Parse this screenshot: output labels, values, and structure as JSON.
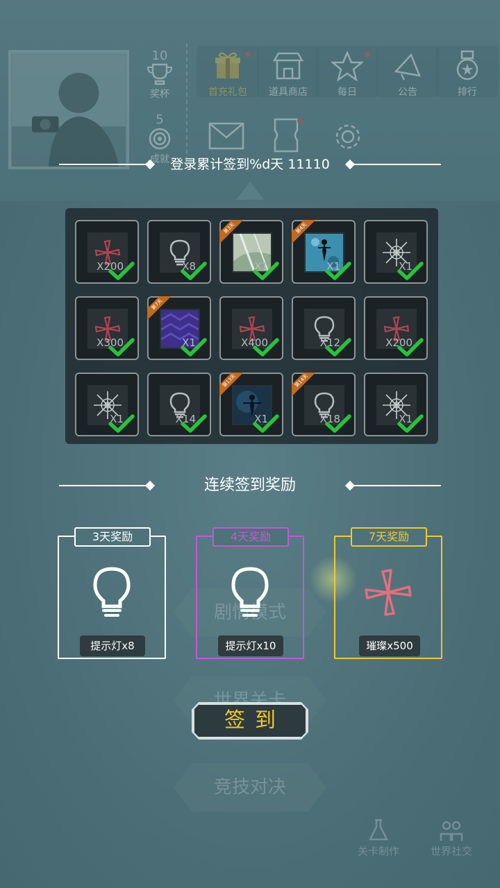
{
  "top_bar": {
    "trophy": {
      "count": "10",
      "label": "奖杯"
    },
    "achievement": {
      "count": "5",
      "label": "成就"
    },
    "shortcuts": [
      {
        "label": "首充礼包",
        "icon": "gift-icon"
      },
      {
        "label": "道具商店",
        "icon": "shop-icon"
      },
      {
        "label": "每日",
        "icon": "star-icon"
      },
      {
        "label": "公告",
        "icon": "megaphone-icon"
      },
      {
        "label": "排行",
        "icon": "medal-icon"
      }
    ]
  },
  "signin": {
    "title": "登录累计签到%d天 11110",
    "grid": [
      {
        "qty": "X200",
        "item": "pinwheel",
        "ribbon": "",
        "checked": true
      },
      {
        "qty": "X8",
        "item": "bulb",
        "ribbon": "",
        "checked": true
      },
      {
        "qty": "X1",
        "item": "scene-card",
        "ribbon": "第3天",
        "checked": true
      },
      {
        "qty": "X1",
        "item": "character-card",
        "ribbon": "第4天",
        "checked": true
      },
      {
        "qty": "X1",
        "item": "snowflake",
        "ribbon": "",
        "checked": true
      },
      {
        "qty": "X300",
        "item": "pinwheel",
        "ribbon": "",
        "checked": true
      },
      {
        "qty": "X1",
        "item": "pattern-card",
        "ribbon": "第7天",
        "checked": true
      },
      {
        "qty": "X400",
        "item": "pinwheel",
        "ribbon": "",
        "checked": true
      },
      {
        "qty": "X12",
        "item": "bulb",
        "ribbon": "",
        "checked": true
      },
      {
        "qty": "X200",
        "item": "pinwheel",
        "ribbon": "",
        "checked": true
      },
      {
        "qty": "X1",
        "item": "snowflake",
        "ribbon": "",
        "checked": true
      },
      {
        "qty": "X14",
        "item": "bulb",
        "ribbon": "",
        "checked": true
      },
      {
        "qty": "X1",
        "item": "night-card",
        "ribbon": "第13天",
        "checked": true
      },
      {
        "qty": "X18",
        "item": "bulb",
        "ribbon": "第14天",
        "checked": true
      },
      {
        "qty": "X1",
        "item": "snowflake",
        "ribbon": "",
        "checked": true
      }
    ]
  },
  "streak": {
    "title": "连续签到奖励",
    "rewards": [
      {
        "tag": "3天奖励",
        "name": "提示灯x8",
        "icon": "bulb-icon"
      },
      {
        "tag": "4天奖励",
        "name": "提示灯x10",
        "icon": "bulb-icon"
      },
      {
        "tag": "7天奖励",
        "name": "璀璨x500",
        "icon": "pinwheel-icon"
      }
    ]
  },
  "sign_button": "签到",
  "background_menu": {
    "items": [
      "剧情模式",
      "世界关卡",
      "竞技对决"
    ],
    "level_editor": "关卡制作",
    "world_social": "世界社交"
  },
  "colors": {
    "accent_gold": "#f5c622",
    "check_green": "#29c23a",
    "purple": "#c05ad6",
    "ribbon_orange": "#c26a1c"
  }
}
